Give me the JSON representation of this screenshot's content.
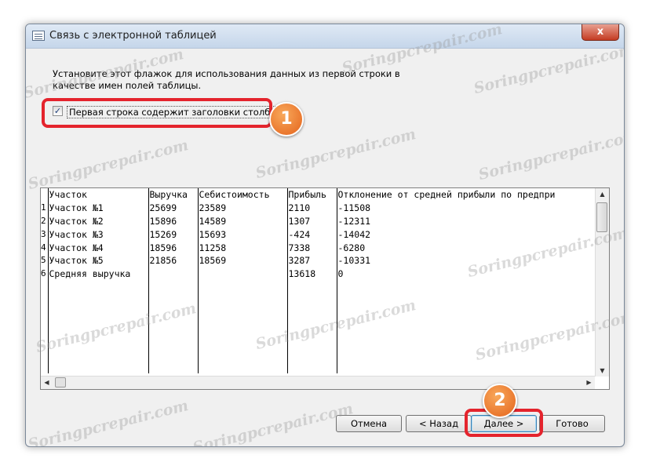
{
  "window": {
    "title": "Связь с электронной таблицей",
    "close_label": "x"
  },
  "instruction": "Установите этот флажок для использования данных из первой строки в качестве имен полей таблицы.",
  "checkbox": {
    "label": "Первая строка содержит заголовки столбцов",
    "checked": true,
    "mark": "✓"
  },
  "badges": {
    "first": "1",
    "second": "2"
  },
  "grid": {
    "headers": [
      "Участок",
      "Выручка",
      "Себистоимость",
      "Прибыль",
      "Отклонение от средней прибыли по предпри"
    ],
    "rows": [
      {
        "n": "1",
        "cells": [
          "Участок №1",
          "25699",
          "23589",
          "2110",
          "-11508"
        ]
      },
      {
        "n": "2",
        "cells": [
          "Участок №2",
          "15896",
          "14589",
          "1307",
          "-12311"
        ]
      },
      {
        "n": "3",
        "cells": [
          "Участок №3",
          "15269",
          "15693",
          "-424",
          "-14042"
        ]
      },
      {
        "n": "4",
        "cells": [
          "Участок №4",
          "18596",
          "11258",
          "7338",
          "-6280"
        ]
      },
      {
        "n": "5",
        "cells": [
          "Участок №5",
          "21856",
          "18569",
          "3287",
          "-10331"
        ]
      },
      {
        "n": "6",
        "cells": [
          "Средняя выручка",
          "",
          "",
          "13618",
          "0"
        ]
      }
    ],
    "empty_rows": 7
  },
  "buttons": {
    "cancel": "Отмена",
    "back": "< Назад",
    "next": "Далее >",
    "finish": "Готово"
  },
  "watermark": "Soringpcrepair.com",
  "colors": {
    "highlight": "#e4242d",
    "badge": "#e4631c"
  }
}
